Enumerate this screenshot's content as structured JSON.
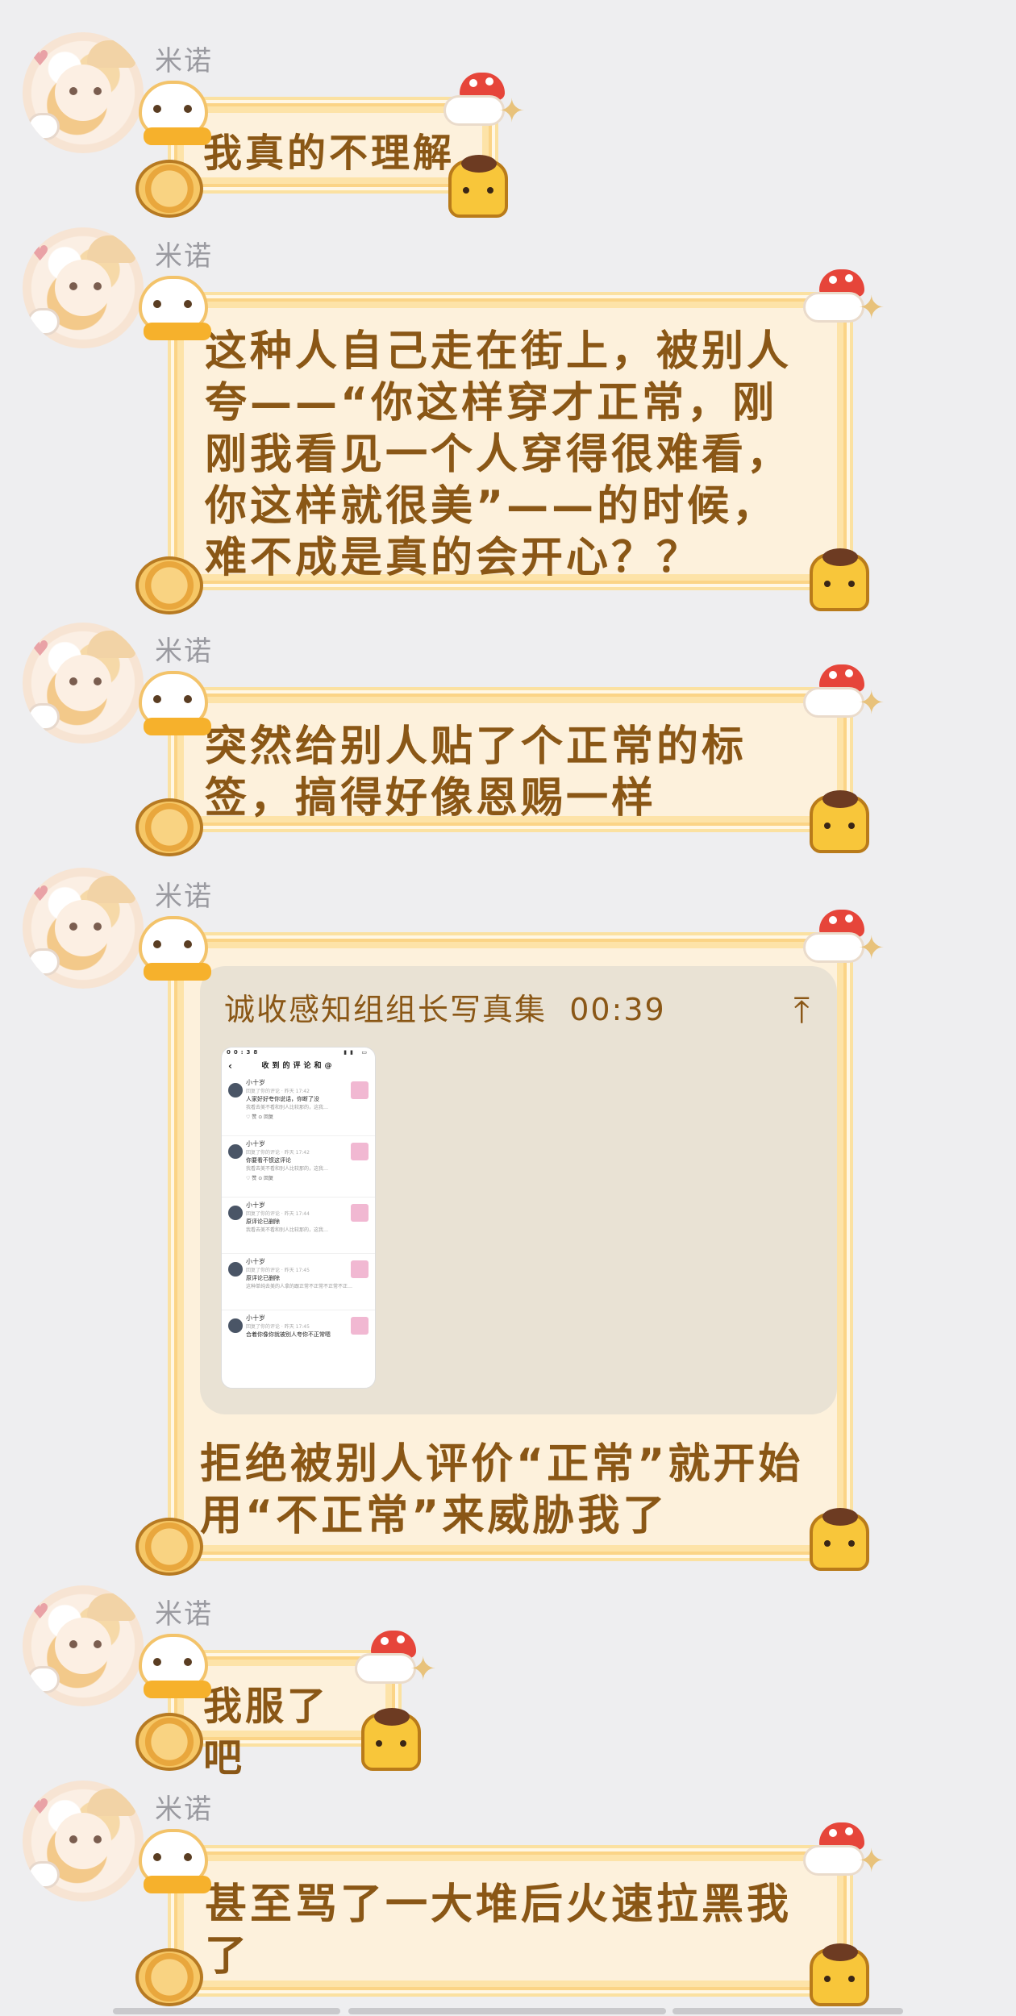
{
  "sender_name": "米诺",
  "messages": [
    {
      "text": "我真的不理解"
    },
    {
      "text": "这种人自己走在街上，被别人夸——“你这样穿才正常，刚刚我看见一个人穿得很难看，你这样就很美”——的时候，难不成是真的会开心？？"
    },
    {
      "text": "突然给别人贴了个正常的标签，搞得好像恩赐一样"
    },
    {
      "file": {
        "title": "诚收感知组组长写真集",
        "duration": "00:39",
        "upload_icon": "arrow-up-icon"
      },
      "thumbnail": {
        "status_left": "00:38",
        "status_right": "▮▮ ▭",
        "header_title": "收到的评论和@",
        "back_icon": "‹",
        "rows": [
          {
            "user": "小十岁",
            "meta": "回复了你的评论 · 昨天 17:42",
            "text": "人家好好夸你说话，你断了没",
            "quote": "我看去美不看和别人比较那的，这我…",
            "actions": "♡ 赞    ⊙ 回复"
          },
          {
            "user": "小十岁",
            "meta": "回复了你的评论 · 昨天 17:42",
            "text": "你要看不惯这评论",
            "quote": "我看去美不看和别人比较那的，这我…",
            "actions": "♡ 赞    ⊙ 回复"
          },
          {
            "user": "小十岁",
            "meta": "回复了你的评论 · 昨天 17:44",
            "text": "原评论已删除",
            "quote": "我看去美不看和别人比较那的，这我…",
            "actions": ""
          },
          {
            "user": "小十岁",
            "meta": "回复了你的评论 · 昨天 17:45",
            "text": "原评论已删除",
            "quote": "这种单纯去美的人拿的跟正常不正常不正常不正…",
            "actions": ""
          },
          {
            "user": "小十岁",
            "meta": "回复了你的评论 · 昨天 17:45",
            "text": "合着你像你就被别人夸你不正常嗯",
            "quote": "",
            "actions": ""
          }
        ]
      },
      "text": "拒绝被别人评价“正常”就开始用“不正常”来威胁我了"
    },
    {
      "text": "我服了吧"
    },
    {
      "text": "甚至骂了一大堆后火速拉黑我了"
    }
  ],
  "colors": {
    "background": "#eeeef0",
    "bubble_fill": "#fdf1dc",
    "bubble_border": "#fde3a8",
    "text": "#8a5716",
    "name": "#9a9aa0"
  }
}
